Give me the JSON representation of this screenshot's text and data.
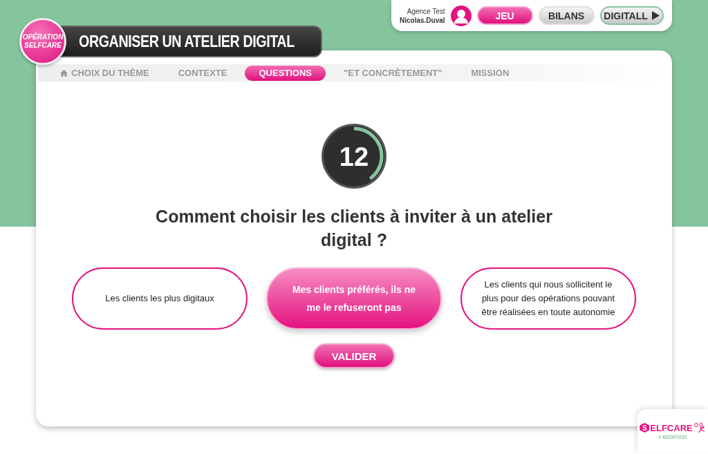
{
  "logo": {
    "line_1": "OPÉRATION",
    "line_2": "SELFCARE"
  },
  "page_title": "ORGANISER UN ATELIER DIGITAL",
  "user": {
    "agency": "Agence Test",
    "name": "Nicolas.Duval"
  },
  "top_buttons": [
    {
      "label": "JEU",
      "kind": "pink"
    },
    {
      "label": "BILANS",
      "kind": "grey"
    },
    {
      "label": "DIGITALL",
      "kind": "play"
    }
  ],
  "steps": [
    {
      "label": "CHOIX DU THÈME",
      "selected": false,
      "kind": "home"
    },
    {
      "label": "CONTEXTE",
      "selected": false,
      "kind": "plain"
    },
    {
      "label": "QUESTIONS",
      "selected": true,
      "kind": "plain"
    },
    {
      "label": "\"ET CONCRÈTEMENT\"",
      "selected": false,
      "kind": "plain"
    },
    {
      "label": "MISSION",
      "selected": false,
      "kind": "plain"
    }
  ],
  "timer": {
    "value": "12",
    "level": 0.4
  },
  "question": "Comment choisir les clients à inviter à un atelier digital ?",
  "answers": [
    {
      "text": "Les clients les plus digitaux",
      "selected": false
    },
    {
      "text": "Mes clients préférés, ils ne me le refuseront pas",
      "selected": true
    },
    {
      "text": "Les clients qui nous sollicitent le plus pour des opérations pouvant être réalisées en toute autonomie",
      "selected": false
    }
  ],
  "submit": "VALIDER",
  "badge": {
    "letter": "S",
    "word": "ELFCARE",
    "hashtag": "# BDDF2020"
  }
}
